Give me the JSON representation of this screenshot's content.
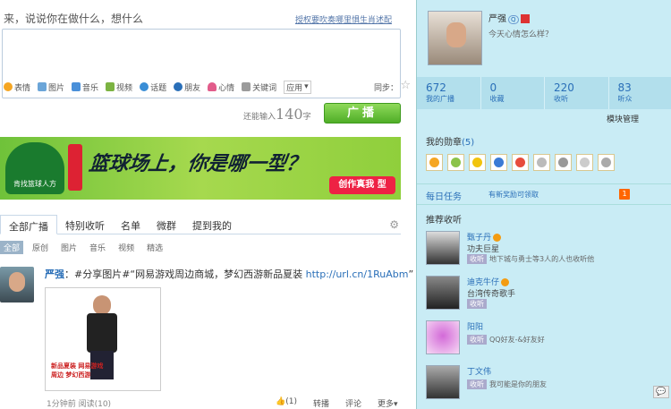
{
  "composer": {
    "prompt": "来，说说你在做什么，想什么",
    "tip": "授权要吹奏哪里惧生肖述配",
    "tools": [
      {
        "label": "表情",
        "icon": "smiley-icon",
        "color": "#f5a623"
      },
      {
        "label": "图片",
        "icon": "image-icon",
        "color": "#6ba5d8"
      },
      {
        "label": "音乐",
        "icon": "music-icon",
        "color": "#4a90d9"
      },
      {
        "label": "视频",
        "icon": "video-icon",
        "color": "#7cb342"
      },
      {
        "label": "话题",
        "icon": "topic-icon",
        "color": "#3a8ed6"
      },
      {
        "label": "朋友",
        "icon": "friend-icon",
        "color": "#2a6fb8"
      },
      {
        "label": "心情",
        "icon": "heart-icon",
        "color": "#e25c8b"
      },
      {
        "label": "关键词",
        "icon": "rss-icon",
        "color": "#9b9b9b"
      },
      {
        "label": "应用",
        "icon": "app-dropdown-icon",
        "color": "#777777"
      }
    ],
    "sync_label": "同步：",
    "remaining_prefix": "还能输入",
    "remaining_count": "140",
    "remaining_suffix": "字",
    "post_button": "广播"
  },
  "banner": {
    "brand": "肯找篮球人方",
    "headline": "篮球场上，你是哪一型？",
    "cta": "创作真我 型"
  },
  "tabs": [
    {
      "label": "全部广播",
      "active": true
    },
    {
      "label": "特别收听",
      "active": false
    },
    {
      "label": "名单",
      "active": false
    },
    {
      "label": "微群",
      "active": false
    },
    {
      "label": "提到我的",
      "active": false
    }
  ],
  "subtabs": [
    {
      "label": "全部",
      "active": true
    },
    {
      "label": "原创",
      "active": false
    },
    {
      "label": "图片",
      "active": false
    },
    {
      "label": "音乐",
      "active": false
    },
    {
      "label": "视频",
      "active": false
    },
    {
      "label": "精选",
      "active": false
    }
  ],
  "feed": {
    "author": "严强",
    "text": "：#分享图片#“网易游戏周边商城，梦幻西游新品夏装",
    "link": "http://url.cn/1RuAbm",
    "text_end": "”",
    "image_caption": "新品夏装 网易游戏周边 梦幻西游",
    "meta": "1分钟前 阅读(10)",
    "actions": [
      "(1)",
      "转播",
      "评论",
      "更多"
    ]
  },
  "profile": {
    "name": "严强",
    "status": "今天心情怎么样？",
    "stats": [
      {
        "num": "672",
        "label": "我的广播"
      },
      {
        "num": "0",
        "label": "收藏"
      },
      {
        "num": "220",
        "label": "收听"
      },
      {
        "num": "83",
        "label": "听众"
      }
    ],
    "module_manager": "模块管理"
  },
  "medals": {
    "title": "我的勋章",
    "count": "(5)",
    "colors": [
      "#f5a623",
      "#8bc34a",
      "#f1c40f",
      "#3a7bd5",
      "#e74c3c",
      "#bbbbbb",
      "#999999",
      "#cccccc",
      "#aaaaaa"
    ]
  },
  "task": {
    "title": "每日任务",
    "link": "有新奖励可领取",
    "count": "1"
  },
  "recommend": {
    "title": "推荐收听",
    "follow_label": "收听",
    "items": [
      {
        "name": "甄子丹",
        "desc": "功夫巨星",
        "line": "地下城与勇士等3人的人也收听他",
        "verified": true
      },
      {
        "name": "迪克牛仔",
        "desc": "台湾传奇歌手",
        "line": "",
        "verified": true
      },
      {
        "name": "阳阳",
        "desc": "",
        "line": "QQ好友-&好友好",
        "verified": false
      },
      {
        "name": "丁文伟",
        "desc": "",
        "line": "我可能是你的朋友",
        "verified": false
      }
    ]
  }
}
